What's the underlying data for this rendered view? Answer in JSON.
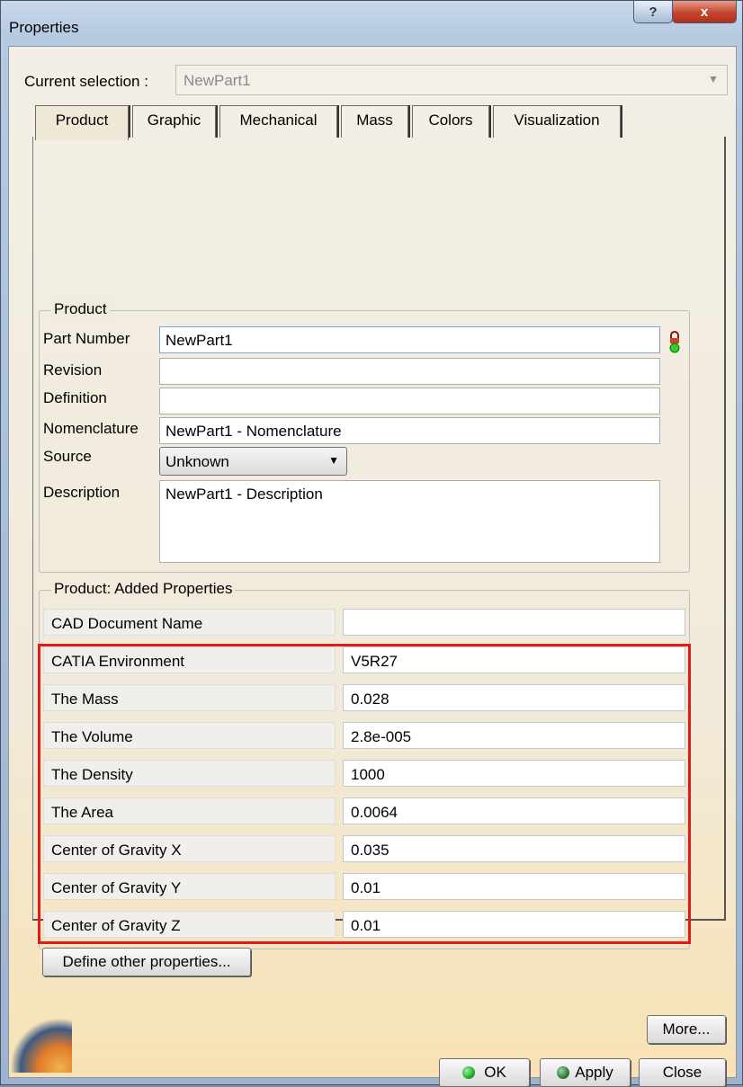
{
  "window": {
    "title": "Properties",
    "help_glyph": "?",
    "close_glyph": "x"
  },
  "selection": {
    "label": "Current selection :",
    "value": "NewPart1"
  },
  "tabs": [
    "Product",
    "Graphic",
    "Mechanical",
    "Mass",
    "Colors",
    "Visualization"
  ],
  "product": {
    "group_title": "Product",
    "part_number_label": "Part Number",
    "part_number": "NewPart1",
    "revision_label": "Revision",
    "revision": "",
    "definition_label": "Definition",
    "definition": "",
    "nomenclature_label": "Nomenclature",
    "nomenclature": "NewPart1 - Nomenclature",
    "source_label": "Source",
    "source": "Unknown",
    "description_label": "Description",
    "description": "NewPart1 - Description"
  },
  "added": {
    "group_title": "Product: Added Properties",
    "rows": [
      {
        "name": "CAD Document Name",
        "value": ""
      },
      {
        "name": "CATIA Environment",
        "value": "V5R27"
      },
      {
        "name": "The Mass",
        "value": "0.028"
      },
      {
        "name": "The Volume",
        "value": "2.8e-005"
      },
      {
        "name": "The Density",
        "value": "1000"
      },
      {
        "name": "The Area",
        "value": "0.0064"
      },
      {
        "name": "Center of Gravity X",
        "value": "0.035"
      },
      {
        "name": "Center of Gravity Y",
        "value": "0.01"
      },
      {
        "name": "Center of Gravity Z",
        "value": "0.01"
      }
    ],
    "define_button": "Define other properties..."
  },
  "buttons": {
    "more": "More...",
    "ok": "OK",
    "apply": "Apply",
    "close": "Close"
  },
  "colors": {
    "highlight": "#e01b1b",
    "ok_dot": "#1fae2a",
    "apply_dot": "#2d7f3a"
  }
}
